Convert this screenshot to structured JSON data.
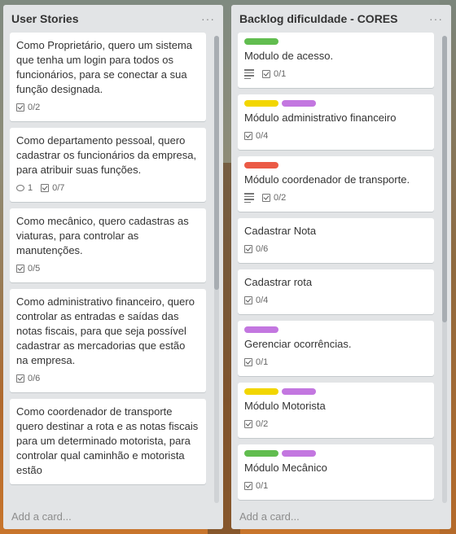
{
  "colors": {
    "green": "#61bd4f",
    "yellow": "#f2d600",
    "purple": "#c377e0",
    "red": "#eb5a46"
  },
  "lists": [
    {
      "title": "User Stories",
      "menu": "···",
      "add_card": "Add a card...",
      "cards": [
        {
          "title": "Como Proprietário, quero um sistema que tenha um login para todos os funcionários, para se conectar a sua função designada.",
          "labels": [],
          "description": false,
          "comments": null,
          "checklist": "0/2"
        },
        {
          "title": "Como departamento pessoal, quero cadastrar os funcionários da empresa, para atribuir suas funções.",
          "labels": [],
          "description": false,
          "comments": "1",
          "checklist": "0/7"
        },
        {
          "title": "Como mecânico, quero cadastras as viaturas, para controlar as manutenções.",
          "labels": [],
          "description": false,
          "comments": null,
          "checklist": "0/5"
        },
        {
          "title": "Como administrativo financeiro, quero controlar as entradas e saídas das notas fiscais, para que seja possível cadastrar as mercadorias que estão na empresa.",
          "labels": [],
          "description": false,
          "comments": null,
          "checklist": "0/6"
        },
        {
          "title": "Como coordenador de transporte quero destinar a rota e as notas fiscais para um determinado motorista, para controlar qual caminhão e motorista estão",
          "labels": [],
          "description": false,
          "comments": null,
          "checklist": null
        }
      ]
    },
    {
      "title": "Backlog dificuldade - CORES",
      "menu": "···",
      "add_card": "Add a card...",
      "cards": [
        {
          "title": "Modulo de acesso.",
          "labels": [
            "green"
          ],
          "description": true,
          "comments": null,
          "checklist": "0/1"
        },
        {
          "title": "Módulo administrativo financeiro",
          "labels": [
            "yellow",
            "purple"
          ],
          "description": false,
          "comments": null,
          "checklist": "0/4"
        },
        {
          "title": "Módulo coordenador de transporte.",
          "labels": [
            "red"
          ],
          "description": true,
          "comments": null,
          "checklist": "0/2"
        },
        {
          "title": "Cadastrar Nota",
          "labels": [],
          "description": false,
          "comments": null,
          "checklist": "0/6"
        },
        {
          "title": "Cadastrar rota",
          "labels": [],
          "description": false,
          "comments": null,
          "checklist": "0/4"
        },
        {
          "title": "Gerenciar ocorrências.",
          "labels": [
            "purple"
          ],
          "description": false,
          "comments": null,
          "checklist": "0/1"
        },
        {
          "title": "Módulo Motorista",
          "labels": [
            "yellow",
            "purple"
          ],
          "description": false,
          "comments": null,
          "checklist": "0/2"
        },
        {
          "title": "Módulo Mecânico",
          "labels": [
            "green",
            "purple"
          ],
          "description": false,
          "comments": null,
          "checklist": "0/1"
        }
      ]
    }
  ]
}
